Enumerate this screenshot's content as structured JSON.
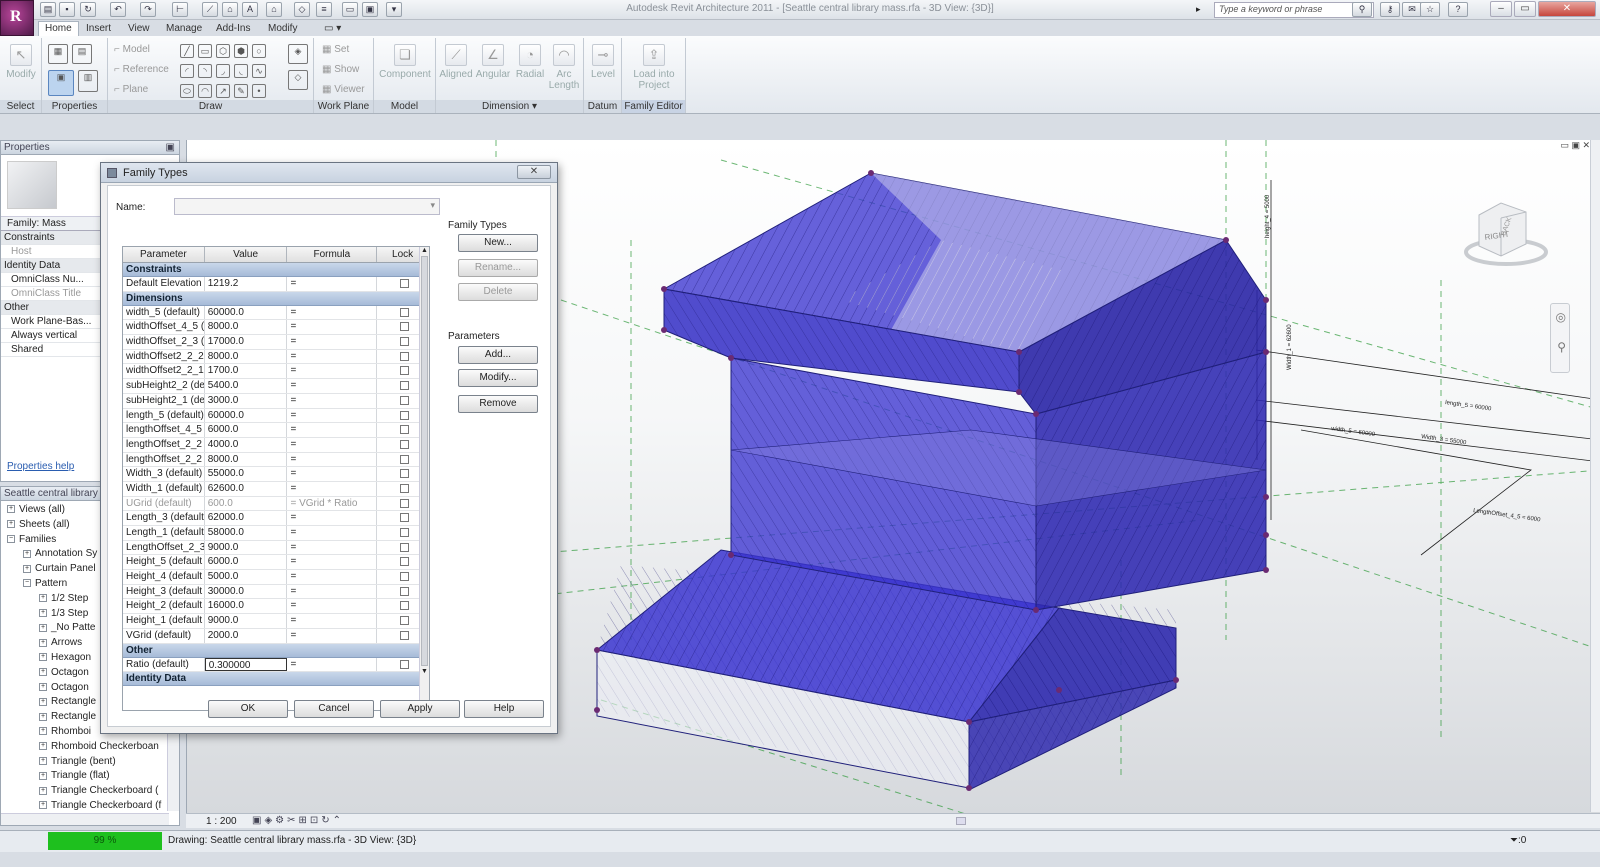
{
  "window": {
    "title": "Autodesk Revit Architecture 2011 - [Seattle central library mass.rfa - 3D View: {3D}]",
    "search_placeholder": "Type a keyword or phrase"
  },
  "tabs": [
    "Home",
    "Insert",
    "View",
    "Manage",
    "Add-Ins",
    "Modify"
  ],
  "ribbon": {
    "panels": [
      "Select",
      "Properties",
      "Draw",
      "Work Plane",
      "Model",
      "Dimension",
      "Datum",
      "Family Editor"
    ],
    "modify": "Modify",
    "draw_small": [
      "Model",
      "Reference",
      "Plane"
    ],
    "workplane_small": [
      "Set",
      "Show",
      "Viewer"
    ],
    "component": "Component",
    "dim_buttons": [
      "Aligned",
      "Angular",
      "Radial",
      "Arc Length"
    ],
    "level": "Level",
    "load": "Load into Project"
  },
  "properties_panel": {
    "title": "Properties",
    "family": "Family: Mass",
    "rows": [
      {
        "t": "Constraints",
        "k": "grp"
      },
      {
        "t": "Host",
        "k": "gray"
      },
      {
        "t": "Identity Data",
        "k": "grp"
      },
      {
        "t": "OmniClass Nu...",
        "k": "ind"
      },
      {
        "t": "OmniClass Title",
        "k": "gray"
      },
      {
        "t": "Other",
        "k": "grp"
      },
      {
        "t": "Work Plane-Bas...",
        "k": "ind"
      },
      {
        "t": "Always vertical",
        "k": "ind"
      },
      {
        "t": "Shared",
        "k": "ind"
      }
    ],
    "help": "Properties help"
  },
  "browser": {
    "title": "Seattle central library m",
    "items": [
      {
        "t": "Views (all)",
        "l": 0
      },
      {
        "t": "Sheets (all)",
        "l": 0
      },
      {
        "t": "Families",
        "l": 0
      },
      {
        "t": "Annotation Sy",
        "l": 1
      },
      {
        "t": "Curtain Panel",
        "l": 1
      },
      {
        "t": "Pattern",
        "l": 1
      },
      {
        "t": "1/2 Step",
        "l": 2
      },
      {
        "t": "1/3 Step",
        "l": 2
      },
      {
        "t": "_No Patte",
        "l": 2
      },
      {
        "t": "Arrows",
        "l": 2
      },
      {
        "t": "Hexagon",
        "l": 2
      },
      {
        "t": "Octagon",
        "l": 2
      },
      {
        "t": "Octagon",
        "l": 2
      },
      {
        "t": "Rectangle",
        "l": 2
      },
      {
        "t": "Rectangle",
        "l": 2
      },
      {
        "t": "Rhomboi",
        "l": 2
      },
      {
        "t": "Rhomboid Checkerboan",
        "l": 2
      },
      {
        "t": "Triangle (bent)",
        "l": 2
      },
      {
        "t": "Triangle (flat)",
        "l": 2
      },
      {
        "t": "Triangle Checkerboard (",
        "l": 2
      },
      {
        "t": "Triangle Checkerboard (f",
        "l": 2
      }
    ]
  },
  "dialog": {
    "title": "Family Types",
    "name_label": "Name:",
    "columns": [
      "Parameter",
      "Value",
      "Formula",
      "Lock"
    ],
    "sections": [
      {
        "name": "Constraints",
        "rows": [
          [
            "Default Elevation",
            "1219.2",
            "="
          ]
        ]
      },
      {
        "name": "Dimensions",
        "rows": [
          [
            "width_5 (default)",
            "60000.0",
            "="
          ],
          [
            "widthOffset_4_5 (",
            "8000.0",
            "="
          ],
          [
            "widthOffset_2_3 (",
            "17000.0",
            "="
          ],
          [
            "widthOffset2_2_2",
            "8000.0",
            "="
          ],
          [
            "widthOffset2_2_1",
            "1700.0",
            "="
          ],
          [
            "subHeight2_2 (de",
            "5400.0",
            "="
          ],
          [
            "subHeight2_1 (de",
            "3000.0",
            "="
          ],
          [
            "length_5 (default)",
            "60000.0",
            "="
          ],
          [
            "lengthOffset_4_5",
            "6000.0",
            "="
          ],
          [
            "lengthOffset_2_2",
            "4000.0",
            "="
          ],
          [
            "lengthOffset_2_2",
            "8000.0",
            "="
          ],
          [
            "Width_3 (default)",
            "55000.0",
            "="
          ],
          [
            "Width_1 (default)",
            "62600.0",
            "="
          ],
          [
            "UGrid (default)",
            "600.0",
            "= VGrid * Ratio"
          ],
          [
            "Length_3 (default",
            "62000.0",
            "="
          ],
          [
            "Length_1 (default",
            "58000.0",
            "="
          ],
          [
            "LengthOffset_2_3",
            "9000.0",
            "="
          ],
          [
            "Height_5 (default",
            "6000.0",
            "="
          ],
          [
            "Height_4 (default",
            "5000.0",
            "="
          ],
          [
            "Height_3 (default",
            "30000.0",
            "="
          ],
          [
            "Height_2 (default",
            "16000.0",
            "="
          ],
          [
            "Height_1 (default",
            "9000.0",
            "="
          ],
          [
            "VGrid (default)",
            "2000.0",
            "="
          ]
        ]
      },
      {
        "name": "Other",
        "rows": [
          [
            "Ratio (default)",
            "0.300000",
            "="
          ]
        ]
      },
      {
        "name": "Identity Data",
        "rows": []
      }
    ],
    "family_types_label": "Family Types",
    "family_types_buttons": [
      "New...",
      "Rename...",
      "Delete"
    ],
    "parameters_label": "Parameters",
    "parameters_buttons": [
      "Add...",
      "Modify...",
      "Remove"
    ],
    "bottom_buttons": [
      "OK",
      "Cancel",
      "Apply",
      "Help"
    ]
  },
  "viewcube": {
    "right": "RIGHT",
    "back": "BACK"
  },
  "view_scale": "1 : 200",
  "status": {
    "progress": "99 %",
    "text": "Drawing: Seattle central library mass.rfa - 3D View: {3D}",
    "filter": ":0"
  },
  "dimension_labels": [
    "length_5 = 60000",
    "height_4 = 5000",
    "width_5 = 60000",
    "Width_3 = 55000",
    "Width_1 = 62600",
    "LengthOffset_4_5 = 6000"
  ],
  "colors": {
    "mass": "#3b35d0",
    "mass_dark": "#25208f",
    "accent": "#3f7ad6",
    "progress": "#1ec01e"
  }
}
